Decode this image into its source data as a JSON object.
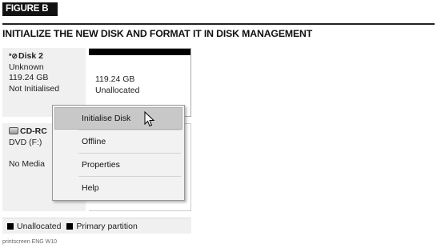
{
  "figure": {
    "label": "FIGURE B",
    "title": "INITIALIZE THE NEW DISK AND FORMAT IT IN DISK MANAGEMENT",
    "caption": "printscreen ENG W10"
  },
  "disk": {
    "name": "Disk 2",
    "type": "Unknown",
    "size": "119.24 GB",
    "status": "Not Initialised"
  },
  "partition": {
    "size": "119.24 GB",
    "status": "Unallocated"
  },
  "cdrom": {
    "name": "CD-RC",
    "drive": "DVD (F:)",
    "media": "No Media"
  },
  "context_menu": {
    "items": [
      {
        "label": "Initialise Disk",
        "selected": true
      },
      {
        "label": "Offline"
      },
      {
        "label": "Properties"
      },
      {
        "label": "Help"
      }
    ]
  },
  "legend": {
    "items": [
      {
        "label": "Unallocated",
        "color": "#000000"
      },
      {
        "label": "Primary partition",
        "color": "#000000"
      }
    ]
  }
}
